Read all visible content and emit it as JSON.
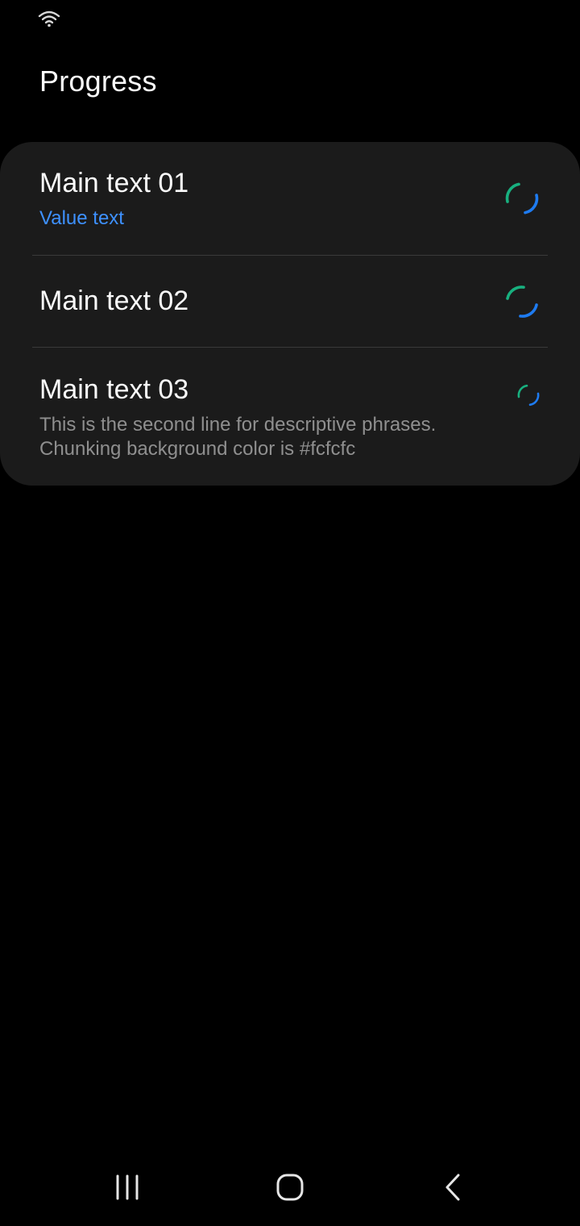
{
  "status_bar": {
    "icons": [
      "wifi-icon"
    ]
  },
  "header": {
    "title": "Progress"
  },
  "list": {
    "items": [
      {
        "title": "Main text 01",
        "value": "Value text",
        "progress_icon": "circular-progress-icon"
      },
      {
        "title": "Main text 02",
        "progress_icon": "circular-progress-icon"
      },
      {
        "title": "Main text 03",
        "description_line1": "This is the second line for descriptive phrases.",
        "description_line2": "Chunking background color is #fcfcfc",
        "progress_icon": "circular-progress-small-icon"
      }
    ]
  },
  "nav_bar": {
    "buttons": [
      "recents-icon",
      "home-icon",
      "back-icon"
    ]
  },
  "colors": {
    "background": "#000000",
    "card": "#1b1b1b",
    "accent_blue": "#3e91ff",
    "progress_green": "#18b07f",
    "progress_blue": "#1e7bf0",
    "divider": "#3a3a3a",
    "secondary_text": "#8f8f8f"
  }
}
